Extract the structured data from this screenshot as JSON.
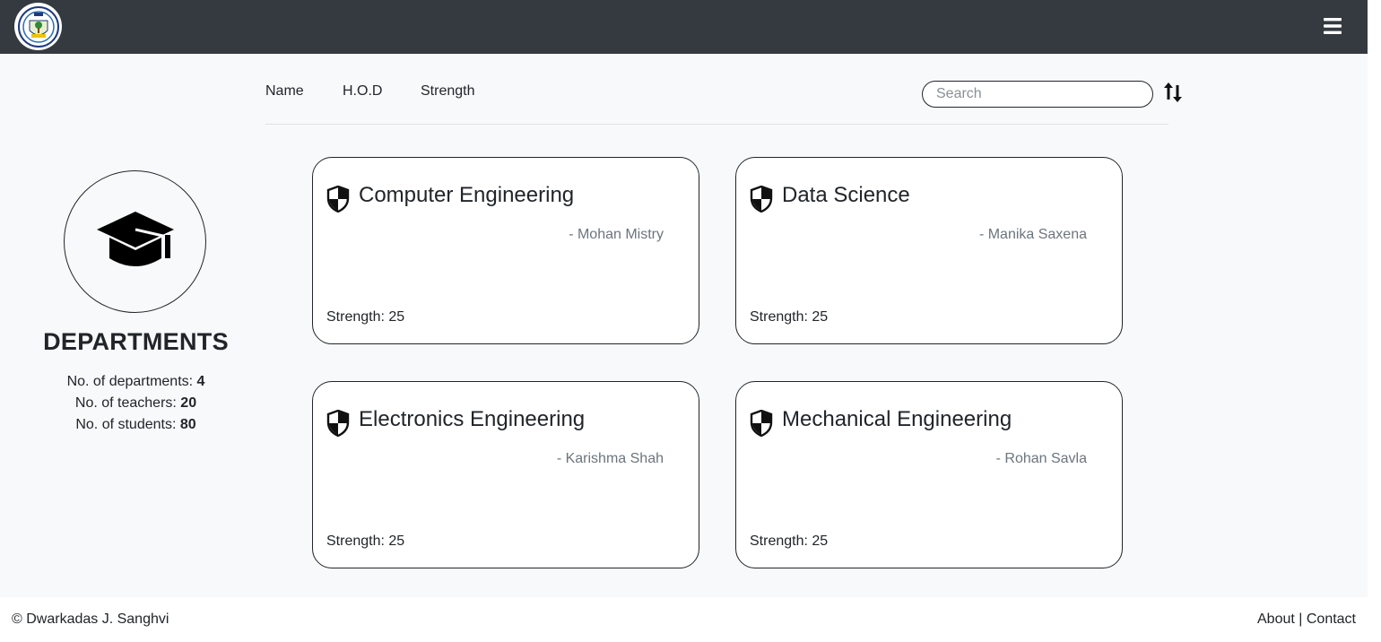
{
  "header": {
    "menu_icon": "hamburger-icon"
  },
  "sortbar": {
    "sort_name": "Name",
    "sort_hod": "H.O.D",
    "sort_strength": "Strength",
    "search_placeholder": "Search",
    "sort_icon": "sort-arrows-icon"
  },
  "summary": {
    "icon": "graduation-cap-icon",
    "title": "DEPARTMENTS",
    "departments_label": "No. of departments: ",
    "departments_value": "4",
    "teachers_label": "No. of teachers: ",
    "teachers_value": "20",
    "students_label": "No. of students: ",
    "students_value": "80"
  },
  "cards": [
    {
      "name": "Computer Engineering",
      "hod": "- Mohan Mistry",
      "strength": "Strength: 25",
      "icon": "shield-icon"
    },
    {
      "name": "Data Science",
      "hod": "- Manika Saxena",
      "strength": "Strength: 25",
      "icon": "shield-icon"
    },
    {
      "name": "Electronics Engineering",
      "hod": "- Karishma Shah",
      "strength": "Strength: 25",
      "icon": "shield-icon"
    },
    {
      "name": "Mechanical Engineering",
      "hod": "- Rohan Savla",
      "strength": "Strength: 25",
      "icon": "shield-icon"
    }
  ],
  "footer": {
    "copyright": "© Dwarkadas J. Sanghvi",
    "about": "About",
    "separator": " | ",
    "contact": "Contact"
  }
}
